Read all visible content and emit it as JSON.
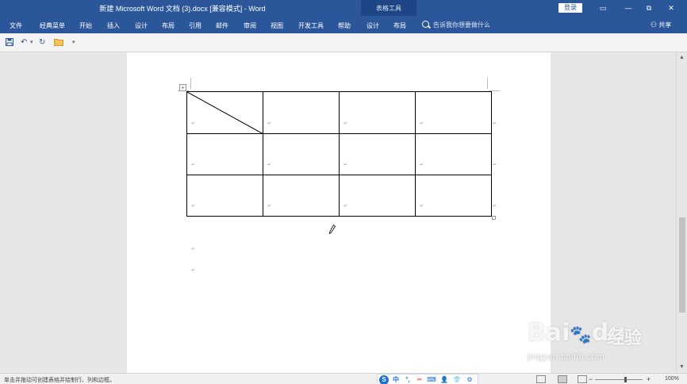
{
  "window": {
    "title": "新建 Microsoft Word 文档 (3).docx [兼容模式]  -  Word",
    "context_group": "表格工具",
    "login_label": "登录",
    "controls": {
      "ribbon_options": "▭",
      "minimize": "—",
      "restore": "⧉",
      "close": "✕"
    }
  },
  "ribbon": {
    "tabs": [
      "文件",
      "经典菜单",
      "开始",
      "插入",
      "设计",
      "布局",
      "引用",
      "邮件",
      "审阅",
      "视图",
      "开发工具",
      "帮助",
      "设计",
      "布局"
    ],
    "tell_me": "告诉我你想要做什么",
    "share": "共享"
  },
  "qat": {
    "icons": [
      "save-icon",
      "undo-icon",
      "redo-icon",
      "folder-icon",
      "customize-icon"
    ]
  },
  "document": {
    "table_handle": "+",
    "cell_mark": "↵",
    "paragraph_mark": "↵",
    "table": {
      "rows": 3,
      "cols": 4,
      "diagonal_cell": "row1-col1"
    }
  },
  "statusbar": {
    "text": "单击并拖动可创建表格并绘制行、列和边框。",
    "zoom": "100%",
    "zoom_minus": "−",
    "zoom_plus": "+",
    "ime_icons": [
      "ime-logo-icon",
      "中",
      "punctuation-icon",
      "scissors-icon",
      "keyboard-icon",
      "user-icon",
      "shirt-icon",
      "settings-icon"
    ]
  },
  "watermark": {
    "brand": "Bai",
    "brand_after": "du",
    "cn": "经验",
    "url": "jingyan.baidu.com"
  },
  "colors": {
    "ribbon": "#2b579a",
    "ribbon_dark": "#1e4686",
    "page": "#ffffff",
    "background": "#e6e6e6"
  }
}
